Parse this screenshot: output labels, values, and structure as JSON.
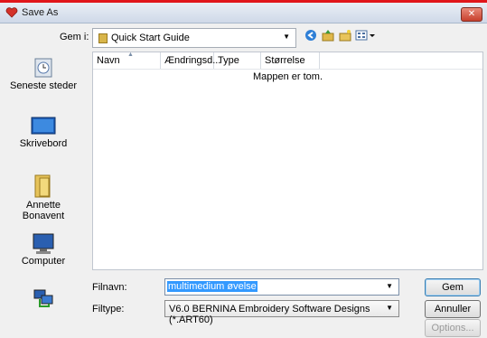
{
  "window": {
    "title": "Save As",
    "close_label": "✕"
  },
  "toolbar": {
    "lookin_label": "Gem i:",
    "lookin_value": "Quick Start Guide",
    "icons": [
      "back-icon",
      "up-folder-icon",
      "new-folder-icon",
      "views-menu-icon"
    ]
  },
  "places": [
    {
      "label": "Seneste steder",
      "icon": "recent-places-icon"
    },
    {
      "label": "Skrivebord",
      "icon": "desktop-icon"
    },
    {
      "label": "Annette Bonavent",
      "icon": "user-folder-icon"
    },
    {
      "label": "Computer",
      "icon": "computer-icon"
    },
    {
      "label": "",
      "icon": "network-icon"
    }
  ],
  "filelist": {
    "columns": [
      "Navn",
      "Ændringsd...",
      "Type",
      "Størrelse"
    ],
    "empty_text": "Mappen er tom."
  },
  "form": {
    "filename_label": "Filnavn:",
    "filename_value": "multimedium øvelse",
    "filetype_label": "Filtype:",
    "filetype_value": "V6.0 BERNINA Embroidery Software Designs (*.ART60)"
  },
  "buttons": {
    "save": "Gem",
    "cancel": "Annuller",
    "options": "Options..."
  },
  "colors": {
    "accent": "#3399ff",
    "selection": "#3399ff",
    "close": "#c7402d"
  }
}
